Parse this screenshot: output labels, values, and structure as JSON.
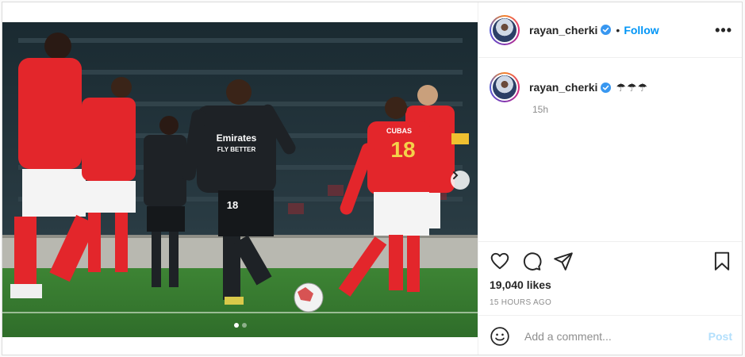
{
  "post": {
    "username": "rayan_cherki",
    "follow_label": "Follow",
    "separator": "•",
    "more_label": "•••",
    "caption": "☂☂☂",
    "caption_time": "15h",
    "likes": "19,040 likes",
    "timestamp": "15 HOURS AGO"
  },
  "comment": {
    "placeholder": "Add a comment...",
    "post_label": "Post"
  },
  "photo": {
    "kits": {
      "home_red": "#e3262b",
      "away_black": "#1e2226",
      "pitch_green": "#3b7d32"
    },
    "shirt_texts": [
      "Emirates FLY BETTER",
      "18",
      "CUBAS",
      "18"
    ]
  },
  "carousel": {
    "slides": 2,
    "active": 1
  },
  "colors": {
    "accent": "#0095f6",
    "verified": "#3897f0"
  },
  "icons": [
    "heart-icon",
    "comment-icon",
    "share-icon",
    "bookmark-icon",
    "emoji-icon",
    "verified-icon",
    "chevron-right-icon"
  ]
}
